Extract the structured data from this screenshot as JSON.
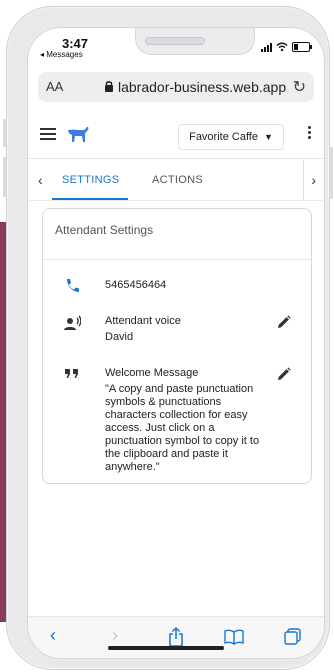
{
  "status_bar": {
    "time": "3:47",
    "back_label": "◂ Messages"
  },
  "browser": {
    "text_size_label": "AA",
    "url": "labrador-business.web.app",
    "reload_icon": "reload-icon"
  },
  "app": {
    "business_selector": {
      "selected": "Favorite Caffe"
    },
    "tabs": [
      {
        "label": "SETTINGS",
        "active": true
      },
      {
        "label": "ACTIONS",
        "active": false
      }
    ]
  },
  "card": {
    "title": "Attendant Settings",
    "phone": {
      "value": "5465456464",
      "icon": "phone-icon"
    },
    "voice": {
      "label": "Attendant voice",
      "value": "David",
      "icon": "voice-icon"
    },
    "welcome": {
      "label": "Welcome Message",
      "value": "\"A copy and paste punctuation symbols & punctuations characters collection for easy access. Just click on a punctuation symbol to copy it to the clipboard and paste it anywhere.\"",
      "icon": "quote-icon"
    }
  },
  "colors": {
    "accent": "#1976d2",
    "side_bg": "#8a3a59"
  }
}
